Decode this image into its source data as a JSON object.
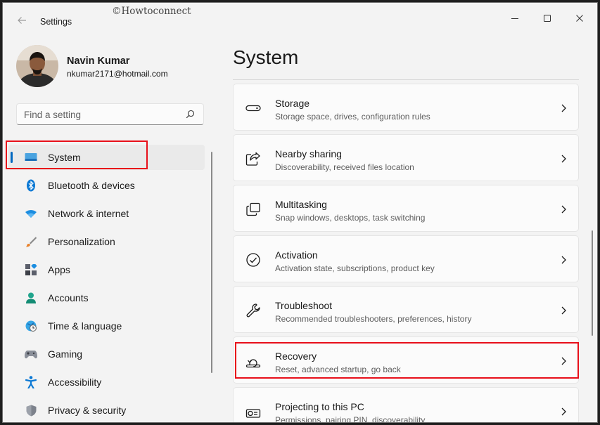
{
  "watermark": "©Howtoconnect",
  "window": {
    "title": "Settings"
  },
  "profile": {
    "name": "Navin Kumar",
    "email": "nkumar2171@hotmail.com"
  },
  "search": {
    "placeholder": "Find a setting"
  },
  "nav": {
    "items": [
      {
        "label": "System",
        "icon": "display-icon",
        "selected": true
      },
      {
        "label": "Bluetooth & devices",
        "icon": "bluetooth-icon"
      },
      {
        "label": "Network & internet",
        "icon": "wifi-icon"
      },
      {
        "label": "Personalization",
        "icon": "brush-icon"
      },
      {
        "label": "Apps",
        "icon": "apps-icon"
      },
      {
        "label": "Accounts",
        "icon": "person-icon"
      },
      {
        "label": "Time & language",
        "icon": "globe-clock-icon"
      },
      {
        "label": "Gaming",
        "icon": "gamepad-icon"
      },
      {
        "label": "Accessibility",
        "icon": "accessibility-icon"
      },
      {
        "label": "Privacy & security",
        "icon": "shield-icon"
      }
    ]
  },
  "main": {
    "title": "System",
    "cards": [
      {
        "title": "Storage",
        "desc": "Storage space, drives, configuration rules",
        "icon": "storage-icon"
      },
      {
        "title": "Nearby sharing",
        "desc": "Discoverability, received files location",
        "icon": "share-icon"
      },
      {
        "title": "Multitasking",
        "desc": "Snap windows, desktops, task switching",
        "icon": "multitasking-icon"
      },
      {
        "title": "Activation",
        "desc": "Activation state, subscriptions, product key",
        "icon": "check-circle-icon"
      },
      {
        "title": "Troubleshoot",
        "desc": "Recommended troubleshooters, preferences, history",
        "icon": "wrench-icon"
      },
      {
        "title": "Recovery",
        "desc": "Reset, advanced startup, go back",
        "icon": "recovery-icon"
      },
      {
        "title": "Projecting to this PC",
        "desc": "Permissions, pairing PIN, discoverability",
        "icon": "projector-icon"
      }
    ]
  },
  "colors": {
    "accent": "#0067c0",
    "highlight": "#e8101a",
    "background": "#f3f3f3",
    "card": "#fbfbfb"
  }
}
